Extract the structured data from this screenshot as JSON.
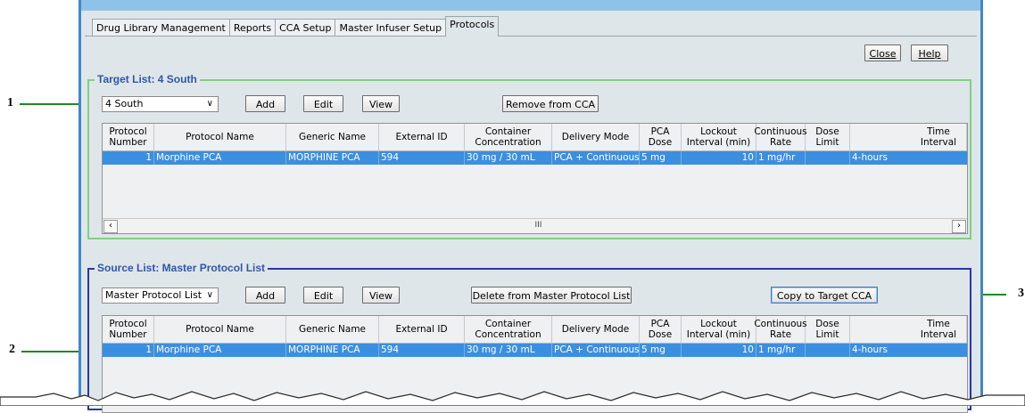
{
  "tabs": [
    "Drug Library Management",
    "Reports",
    "CCA Setup",
    "Master Infuser Setup",
    "Protocols"
  ],
  "active_tab": "Protocols",
  "toolbar": {
    "close_label": "Close",
    "help_label": "Help"
  },
  "target": {
    "title": "Target List: 4 South",
    "select_value": "4 South",
    "add_label": "Add",
    "edit_label": "Edit",
    "view_label": "View",
    "remove_label": "Remove from CCA"
  },
  "source": {
    "title": "Source List: Master Protocol List",
    "select_value": "Master Protocol List",
    "add_label": "Add",
    "edit_label": "Edit",
    "view_label": "View",
    "delete_label": "Delete from Master Protocol List",
    "copy_label": "Copy to Target CCA"
  },
  "columns": [
    "Protocol Number",
    "Protocol Name",
    "Generic Name",
    "External ID",
    "Container Concentration",
    "Delivery Mode",
    "PCA Dose",
    "Lockout Interval (min)",
    "Continuous Rate",
    "Dose Limit",
    "Time Interval"
  ],
  "row": {
    "number": "1",
    "name": "Morphine PCA",
    "generic": "MORPHINE PCA",
    "external_id": "594",
    "concentration": "30 mg / 30 mL",
    "delivery": "PCA + Continuous",
    "pca_dose": "5 mg",
    "lockout": "10",
    "rate": "1 mg/hr",
    "dose_limit": "",
    "interval": "4-hours"
  },
  "scroll_mark": "III",
  "annotations": {
    "one": "1",
    "two": "2",
    "three": "3"
  },
  "icons": {
    "dropdown": "chevron-down-icon",
    "scroll_left": "arrow-left-icon",
    "scroll_right": "arrow-right-icon"
  }
}
